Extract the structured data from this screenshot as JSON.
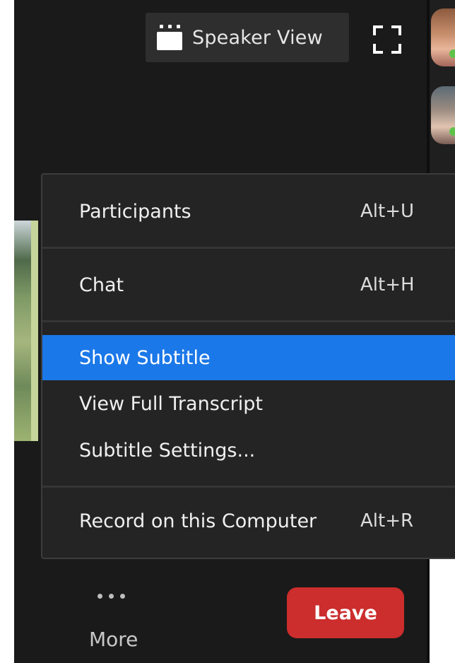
{
  "toolbar": {
    "speaker_view_label": "Speaker View",
    "speaker_view_icon": "gallery-speaker-icon",
    "fullscreen_icon": "fullscreen-icon"
  },
  "menu": {
    "items": [
      {
        "label": "Participants",
        "shortcut": "Alt+U"
      },
      {
        "label": "Chat",
        "shortcut": "Alt+H"
      },
      {
        "label": "Show Subtitle",
        "shortcut": "",
        "highlighted": true
      },
      {
        "label": "View Full Transcript",
        "shortcut": ""
      },
      {
        "label": "Subtitle Settings...",
        "shortcut": ""
      },
      {
        "label": "Record on this Computer",
        "shortcut": "Alt+R"
      }
    ],
    "highlight_color": "#1b78e8"
  },
  "bottom_bar": {
    "more_label": "More",
    "more_icon": "ellipsis-icon",
    "leave_label": "Leave",
    "leave_color": "#cc2d2d"
  },
  "participants": {
    "thumbnail_count": 2,
    "status_color": "#5fc34a"
  }
}
